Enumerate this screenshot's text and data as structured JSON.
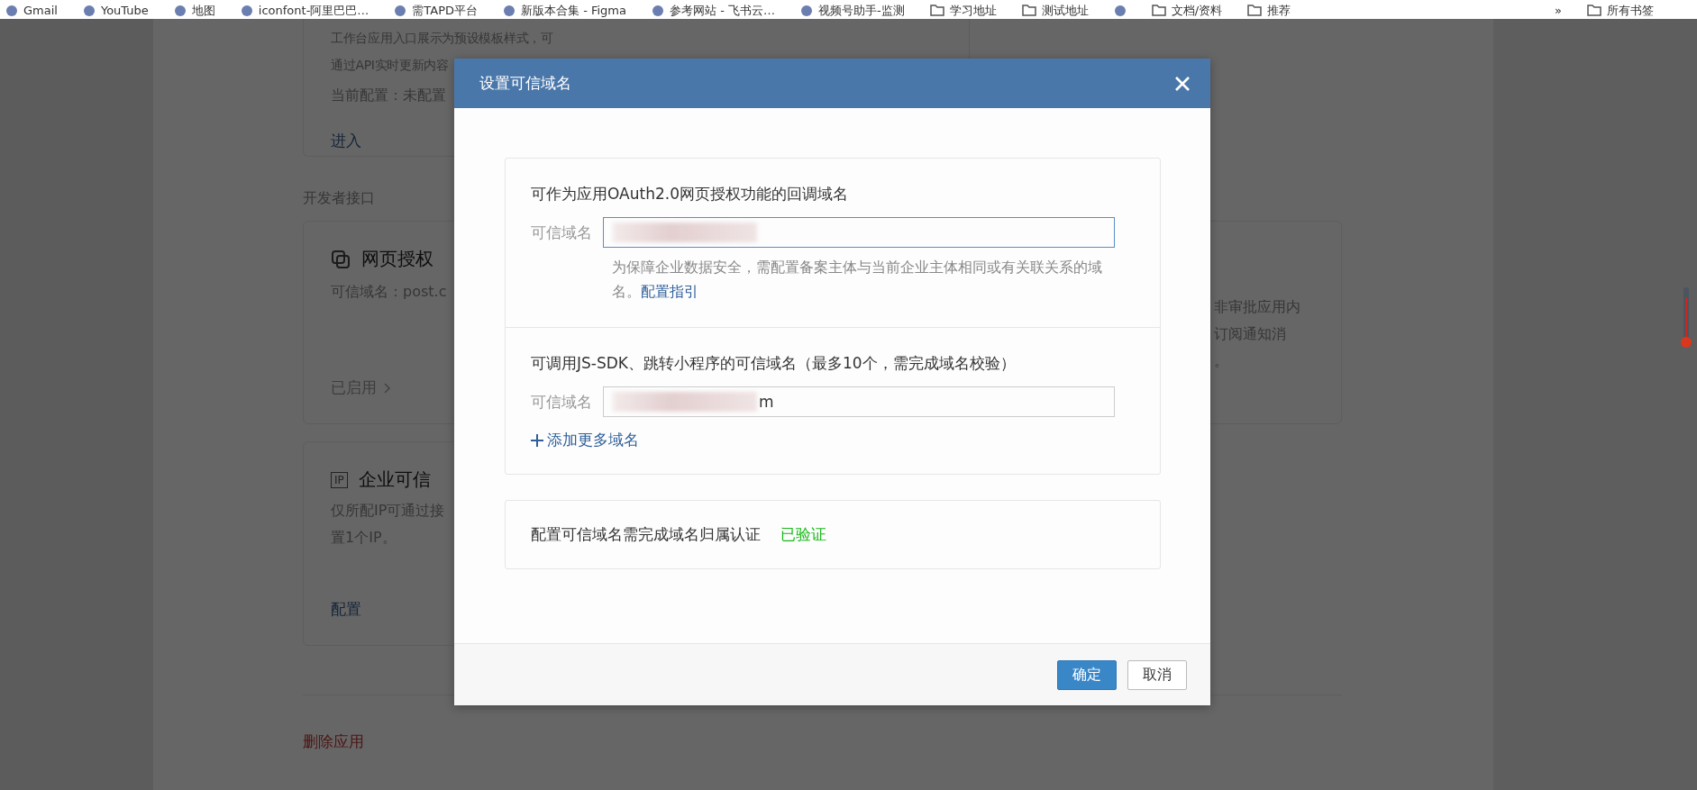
{
  "bookmarks": [
    {
      "label": "Gmail",
      "kind": "site"
    },
    {
      "label": "YouTube",
      "kind": "site"
    },
    {
      "label": "地图",
      "kind": "site"
    },
    {
      "label": "iconfont-阿里巴巴…",
      "kind": "site"
    },
    {
      "label": "需TAPD平台",
      "kind": "site"
    },
    {
      "label": "新版本合集 - Figma",
      "kind": "site"
    },
    {
      "label": "参考网站 - 飞书云…",
      "kind": "site"
    },
    {
      "label": "视频号助手-监测",
      "kind": "site"
    },
    {
      "label": "学习地址",
      "kind": "folder"
    },
    {
      "label": "测试地址",
      "kind": "folder"
    },
    {
      "kind": "site_icon_only"
    },
    {
      "label": "文档/资料",
      "kind": "folder"
    },
    {
      "label": "推荐",
      "kind": "folder"
    }
  ],
  "bookmarks_more": "»",
  "all_bookmarks": "所有书签",
  "page": {
    "top_card": {
      "lines": [
        "工作台应用入口展示为预设模板样式，可",
        "通过API实时更新内容"
      ],
      "config": "当前配置：未配置",
      "link": "进入"
    },
    "section_title": "开发者接口",
    "web_auth_card": {
      "title": "网页授权",
      "desc": "可信域名：post.c",
      "status": "已启用"
    },
    "notify_card": {
      "lines": [
        "非审批应用内",
        "订阅通知消",
        "。"
      ]
    },
    "ip_card": {
      "badge": "IP",
      "title": "企业可信",
      "lines": [
        "仅所配IP可通过接",
        "置1个IP。"
      ],
      "link": "配置"
    },
    "delete_link": "删除应用"
  },
  "dialog": {
    "title": "设置可信域名",
    "sections": [
      {
        "title": "可作为应用OAuth2.0网页授权功能的回调域名",
        "field": {
          "label": "可信域名",
          "redacted": true,
          "focused": true
        },
        "hint": "为保障企业数据安全，需配置备案主体与当前企业主体相同或有关联关系的域名。",
        "hint_link": "配置指引"
      },
      {
        "title": "可调用JS-SDK、跳转小程序的可信域名（最多10个，需完成域名校验）",
        "field": {
          "label": "可信域名",
          "redacted": true,
          "focused": false,
          "value": "m"
        },
        "add_link": "添加更多域名"
      }
    ],
    "verify": {
      "text": "配置可信域名需完成域名归属认证",
      "status": "已验证"
    },
    "buttons": [
      {
        "label": "确定",
        "primary": true
      },
      {
        "label": "取消",
        "primary": false
      }
    ]
  }
}
